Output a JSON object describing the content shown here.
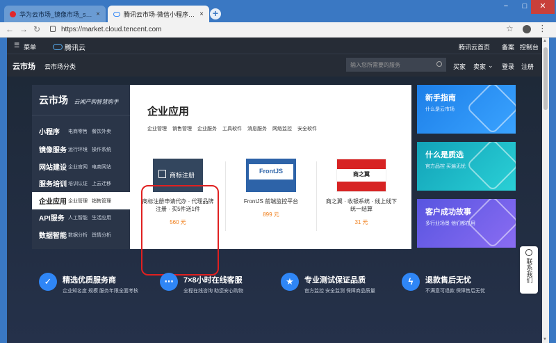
{
  "browser": {
    "tabs": [
      {
        "title": "华为云市场_镜像市场_saas软件",
        "close": "×"
      },
      {
        "title": "腾讯云市场-微信小程序_网站建设",
        "close": "×"
      }
    ],
    "new_tab": "+",
    "url": "https://market.cloud.tencent.com",
    "window_controls": [
      "−",
      "□",
      "✕"
    ]
  },
  "topbar": {
    "menu_label": "菜单",
    "logo_text": "腾讯云",
    "links": [
      "腾讯云首页",
      "备案",
      "控制台"
    ]
  },
  "header": {
    "brand": "云市场",
    "category_link": "云市场分类",
    "search_placeholder": "输入您所需要的服务",
    "right_links": [
      "买家",
      "卖家",
      "登录",
      "注册"
    ]
  },
  "left_nav": {
    "title": "云市场",
    "slogan": "云闻产购智慧购手",
    "items": [
      {
        "main": "小程序",
        "subs": [
          "电商零售",
          "餐饮外卖"
        ]
      },
      {
        "main": "镜像服务",
        "subs": [
          "运行环境",
          "操作系统"
        ]
      },
      {
        "main": "网站建设",
        "subs": [
          "企业官网",
          "电商网站"
        ]
      },
      {
        "main": "服务培训",
        "subs": [
          "培训认证",
          "上云迁移"
        ]
      },
      {
        "main": "企业应用",
        "subs": [
          "企业管理",
          "销售管理"
        ]
      },
      {
        "main": "API服务",
        "subs": [
          "人工智能",
          "生活应用"
        ]
      },
      {
        "main": "数据智能",
        "subs": [
          "数据分析",
          "舆情分析"
        ]
      }
    ]
  },
  "content": {
    "title": "企业应用",
    "tabs": [
      "企业管理",
      "销售管理",
      "企业服务",
      "工具软件",
      "消息服务",
      "网络监控",
      "安全软件"
    ],
    "products": [
      {
        "image_text": "商标注册",
        "name": "商标注册申请代办 · 代理品牌注册 · 买5件送1件",
        "price": "560 元"
      },
      {
        "image_text": "FrontJS",
        "name": "FrontJS 前端监控平台",
        "price": "899 元"
      },
      {
        "image_text": "商之翼",
        "name": "商之翼 · 收银系统 · 线上线下统一结算",
        "price": "31 元"
      }
    ]
  },
  "promos": [
    {
      "title": "新手指南",
      "subtitle": "什么是云市场"
    },
    {
      "title": "什么是质选",
      "subtitle": "官方品控 买遍无忧"
    },
    {
      "title": "客户成功故事",
      "subtitle": "多行业场景 他们都在用"
    }
  ],
  "contact": {
    "label": "联系我们"
  },
  "features": [
    {
      "title": "精选优质服务商",
      "subtitle": "企业知名度 规模 服务年限全面考核",
      "icon": "check-icon"
    },
    {
      "title": "7×8小时在线客服",
      "subtitle": "全程在线咨询 助您安心购物",
      "icon": "chat-icon"
    },
    {
      "title": "专业测试保证品质",
      "subtitle": "官方监控 安全监测 保障商品质量",
      "icon": "star-shield-icon"
    },
    {
      "title": "退款售后无忧",
      "subtitle": "不满意可退款 保障售后无忧",
      "icon": "lightning-icon"
    }
  ],
  "colors": {
    "accent": "#2f86f6",
    "price": "#f07e1a",
    "highlight": "#e02020"
  }
}
